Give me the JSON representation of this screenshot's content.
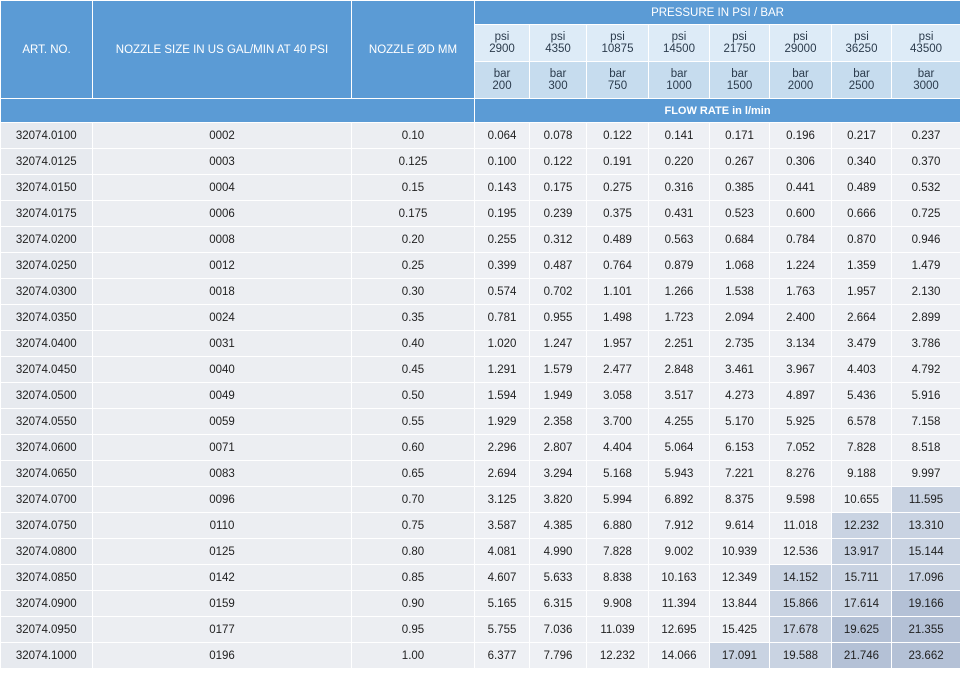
{
  "headers": {
    "art_no": "ART. NO.",
    "nozzle_size": "NOZZLE SIZE IN US GAL/MIN AT 40 PSI",
    "nozzle_diameter": "NOZZLE ØD MM",
    "pressure": "PRESSURE IN PSI / BAR",
    "flow_rate": "FLOW RATE in l/min"
  },
  "pressures": [
    {
      "psi_label": "psi",
      "psi": "2900",
      "bar_label": "bar",
      "bar": "200"
    },
    {
      "psi_label": "psi",
      "psi": "4350",
      "bar_label": "bar",
      "bar": "300"
    },
    {
      "psi_label": "psi",
      "psi": "10875",
      "bar_label": "bar",
      "bar": "750"
    },
    {
      "psi_label": "psi",
      "psi": "14500",
      "bar_label": "bar",
      "bar": "1000"
    },
    {
      "psi_label": "psi",
      "psi": "21750",
      "bar_label": "bar",
      "bar": "1500"
    },
    {
      "psi_label": "psi",
      "psi": "29000",
      "bar_label": "bar",
      "bar": "2000"
    },
    {
      "psi_label": "psi",
      "psi": "36250",
      "bar_label": "bar",
      "bar": "2500"
    },
    {
      "psi_label": "psi",
      "psi": "43500",
      "bar_label": "bar",
      "bar": "3000"
    }
  ],
  "colors": {
    "header_blue": "#5b9bd5",
    "psi_cell": "#ddebf7",
    "bar_cell": "#c6dcee",
    "highlight_light": "#c9d3e2",
    "highlight_dark": "#b4c1d6"
  },
  "rows": [
    {
      "art": "32074.0100",
      "size": "0002",
      "dia": "0.10",
      "flows": [
        "0.064",
        "0.078",
        "0.122",
        "0.141",
        "0.171",
        "0.196",
        "0.217",
        "0.237"
      ],
      "hl": [
        0,
        0,
        0,
        0,
        0,
        0,
        0,
        0
      ]
    },
    {
      "art": "32074.0125",
      "size": "0003",
      "dia": "0.125",
      "flows": [
        "0.100",
        "0.122",
        "0.191",
        "0.220",
        "0.267",
        "0.306",
        "0.340",
        "0.370"
      ],
      "hl": [
        0,
        0,
        0,
        0,
        0,
        0,
        0,
        0
      ]
    },
    {
      "art": "32074.0150",
      "size": "0004",
      "dia": "0.15",
      "flows": [
        "0.143",
        "0.175",
        "0.275",
        "0.316",
        "0.385",
        "0.441",
        "0.489",
        "0.532"
      ],
      "hl": [
        0,
        0,
        0,
        0,
        0,
        0,
        0,
        0
      ]
    },
    {
      "art": "32074.0175",
      "size": "0006",
      "dia": "0.175",
      "flows": [
        "0.195",
        "0.239",
        "0.375",
        "0.431",
        "0.523",
        "0.600",
        "0.666",
        "0.725"
      ],
      "hl": [
        0,
        0,
        0,
        0,
        0,
        0,
        0,
        0
      ]
    },
    {
      "art": "32074.0200",
      "size": "0008",
      "dia": "0.20",
      "flows": [
        "0.255",
        "0.312",
        "0.489",
        "0.563",
        "0.684",
        "0.784",
        "0.870",
        "0.946"
      ],
      "hl": [
        0,
        0,
        0,
        0,
        0,
        0,
        0,
        0
      ]
    },
    {
      "art": "32074.0250",
      "size": "0012",
      "dia": "0.25",
      "flows": [
        "0.399",
        "0.487",
        "0.764",
        "0.879",
        "1.068",
        "1.224",
        "1.359",
        "1.479"
      ],
      "hl": [
        0,
        0,
        0,
        0,
        0,
        0,
        0,
        0
      ]
    },
    {
      "art": "32074.0300",
      "size": "0018",
      "dia": "0.30",
      "flows": [
        "0.574",
        "0.702",
        "1.101",
        "1.266",
        "1.538",
        "1.763",
        "1.957",
        "2.130"
      ],
      "hl": [
        0,
        0,
        0,
        0,
        0,
        0,
        0,
        0
      ]
    },
    {
      "art": "32074.0350",
      "size": "0024",
      "dia": "0.35",
      "flows": [
        "0.781",
        "0.955",
        "1.498",
        "1.723",
        "2.094",
        "2.400",
        "2.664",
        "2.899"
      ],
      "hl": [
        0,
        0,
        0,
        0,
        0,
        0,
        0,
        0
      ]
    },
    {
      "art": "32074.0400",
      "size": "0031",
      "dia": "0.40",
      "flows": [
        "1.020",
        "1.247",
        "1.957",
        "2.251",
        "2.735",
        "3.134",
        "3.479",
        "3.786"
      ],
      "hl": [
        0,
        0,
        0,
        0,
        0,
        0,
        0,
        0
      ]
    },
    {
      "art": "32074.0450",
      "size": "0040",
      "dia": "0.45",
      "flows": [
        "1.291",
        "1.579",
        "2.477",
        "2.848",
        "3.461",
        "3.967",
        "4.403",
        "4.792"
      ],
      "hl": [
        0,
        0,
        0,
        0,
        0,
        0,
        0,
        0
      ]
    },
    {
      "art": "32074.0500",
      "size": "0049",
      "dia": "0.50",
      "flows": [
        "1.594",
        "1.949",
        "3.058",
        "3.517",
        "4.273",
        "4.897",
        "5.436",
        "5.916"
      ],
      "hl": [
        0,
        0,
        0,
        0,
        0,
        0,
        0,
        0
      ]
    },
    {
      "art": "32074.0550",
      "size": "0059",
      "dia": "0.55",
      "flows": [
        "1.929",
        "2.358",
        "3.700",
        "4.255",
        "5.170",
        "5.925",
        "6.578",
        "7.158"
      ],
      "hl": [
        0,
        0,
        0,
        0,
        0,
        0,
        0,
        0
      ]
    },
    {
      "art": "32074.0600",
      "size": "0071",
      "dia": "0.60",
      "flows": [
        "2.296",
        "2.807",
        "4.404",
        "5.064",
        "6.153",
        "7.052",
        "7.828",
        "8.518"
      ],
      "hl": [
        0,
        0,
        0,
        0,
        0,
        0,
        0,
        0
      ]
    },
    {
      "art": "32074.0650",
      "size": "0083",
      "dia": "0.65",
      "flows": [
        "2.694",
        "3.294",
        "5.168",
        "5.943",
        "7.221",
        "8.276",
        "9.188",
        "9.997"
      ],
      "hl": [
        0,
        0,
        0,
        0,
        0,
        0,
        0,
        0
      ]
    },
    {
      "art": "32074.0700",
      "size": "0096",
      "dia": "0.70",
      "flows": [
        "3.125",
        "3.820",
        "5.994",
        "6.892",
        "8.375",
        "9.598",
        "10.655",
        "11.595"
      ],
      "hl": [
        0,
        0,
        0,
        0,
        0,
        0,
        0,
        1
      ]
    },
    {
      "art": "32074.0750",
      "size": "0110",
      "dia": "0.75",
      "flows": [
        "3.587",
        "4.385",
        "6.880",
        "7.912",
        "9.614",
        "11.018",
        "12.232",
        "13.310"
      ],
      "hl": [
        0,
        0,
        0,
        0,
        0,
        0,
        1,
        1
      ]
    },
    {
      "art": "32074.0800",
      "size": "0125",
      "dia": "0.80",
      "flows": [
        "4.081",
        "4.990",
        "7.828",
        "9.002",
        "10.939",
        "12.536",
        "13.917",
        "15.144"
      ],
      "hl": [
        0,
        0,
        0,
        0,
        0,
        0,
        1,
        1
      ]
    },
    {
      "art": "32074.0850",
      "size": "0142",
      "dia": "0.85",
      "flows": [
        "4.607",
        "5.633",
        "8.838",
        "10.163",
        "12.349",
        "14.152",
        "15.711",
        "17.096"
      ],
      "hl": [
        0,
        0,
        0,
        0,
        0,
        1,
        1,
        1
      ]
    },
    {
      "art": "32074.0900",
      "size": "0159",
      "dia": "0.90",
      "flows": [
        "5.165",
        "6.315",
        "9.908",
        "11.394",
        "13.844",
        "15.866",
        "17.614",
        "19.166"
      ],
      "hl": [
        0,
        0,
        0,
        0,
        0,
        1,
        1,
        2
      ]
    },
    {
      "art": "32074.0950",
      "size": "0177",
      "dia": "0.95",
      "flows": [
        "5.755",
        "7.036",
        "11.039",
        "12.695",
        "15.425",
        "17.678",
        "19.625",
        "21.355"
      ],
      "hl": [
        0,
        0,
        0,
        0,
        0,
        1,
        2,
        2
      ]
    },
    {
      "art": "32074.1000",
      "size": "0196",
      "dia": "1.00",
      "flows": [
        "6.377",
        "7.796",
        "12.232",
        "14.066",
        "17.091",
        "19.588",
        "21.746",
        "23.662"
      ],
      "hl": [
        0,
        0,
        0,
        0,
        1,
        1,
        2,
        2
      ]
    }
  ]
}
